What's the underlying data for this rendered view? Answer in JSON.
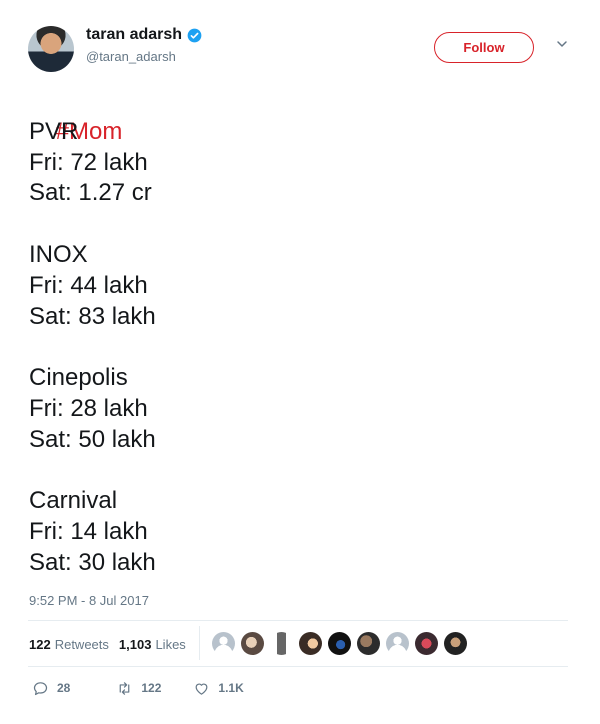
{
  "author": {
    "display_name": "taran adarsh",
    "handle": "@taran_adarsh",
    "verified": true
  },
  "follow_button": {
    "label": "Follow"
  },
  "tweet": {
    "hashtag": "#Mom",
    "lines": [
      "PVR",
      "Fri: 72 lakh",
      "Sat: 1.27 cr",
      "",
      "INOX",
      "Fri: 44 lakh",
      "Sat: 83 lakh",
      "",
      "Cinepolis",
      "Fri: 28 lakh",
      "Sat: 50 lakh",
      "",
      "Carnival",
      "Fri: 14 lakh",
      "Sat: 30 lakh"
    ],
    "timestamp": "9:52 PM - 8 Jul 2017"
  },
  "stats": {
    "retweets_count": "122",
    "retweets_label": "Retweets",
    "likes_count": "1,103",
    "likes_label": "Likes"
  },
  "actions": {
    "reply_count": "28",
    "retweet_count": "122",
    "like_count": "1.1K"
  },
  "colors": {
    "accent": "#d8232a",
    "verified_blue": "#1da1f2",
    "muted_text": "#657786",
    "divider": "#e6ecf0"
  },
  "icons": [
    "verified-badge-icon",
    "chevron-down-icon",
    "reply-icon",
    "retweet-icon",
    "heart-icon"
  ]
}
